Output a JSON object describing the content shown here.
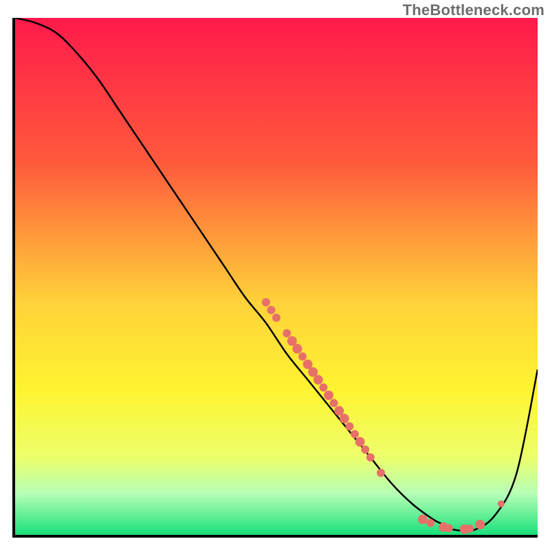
{
  "watermark": "TheBottleneck.com",
  "chart_data": {
    "type": "line",
    "title": "",
    "xlabel": "",
    "ylabel": "",
    "xlim": [
      0,
      100
    ],
    "ylim": [
      0,
      100
    ],
    "grid": false,
    "legend": false,
    "gradient_stops": [
      {
        "offset": 0,
        "color": "#ff1a4b"
      },
      {
        "offset": 28,
        "color": "#ff5a3c"
      },
      {
        "offset": 55,
        "color": "#ffd23a"
      },
      {
        "offset": 72,
        "color": "#fff431"
      },
      {
        "offset": 85,
        "color": "#ecff6b"
      },
      {
        "offset": 92,
        "color": "#b7ffb7"
      },
      {
        "offset": 100,
        "color": "#18e07a"
      }
    ],
    "series": [
      {
        "name": "bottleneck-curve",
        "x": [
          0,
          4,
          8,
          12,
          16,
          20,
          24,
          28,
          32,
          36,
          40,
          44,
          48,
          52,
          56,
          60,
          64,
          68,
          72,
          76,
          80,
          82,
          84,
          88,
          92,
          96,
          100
        ],
        "y": [
          100,
          99,
          97,
          93,
          88,
          82,
          76,
          70,
          64,
          58,
          52,
          46,
          41,
          35,
          30,
          25,
          20,
          15,
          10,
          6,
          3,
          2,
          1,
          1,
          4,
          12,
          32
        ]
      }
    ],
    "points": [
      {
        "x": 48,
        "y": 45,
        "r": 6
      },
      {
        "x": 49,
        "y": 43.5,
        "r": 6
      },
      {
        "x": 50,
        "y": 42,
        "r": 6
      },
      {
        "x": 52,
        "y": 39,
        "r": 6
      },
      {
        "x": 53,
        "y": 37.5,
        "r": 7
      },
      {
        "x": 54,
        "y": 36,
        "r": 7
      },
      {
        "x": 55,
        "y": 34.5,
        "r": 6
      },
      {
        "x": 56,
        "y": 33,
        "r": 7
      },
      {
        "x": 57,
        "y": 31.5,
        "r": 7
      },
      {
        "x": 58,
        "y": 30,
        "r": 7
      },
      {
        "x": 59,
        "y": 28.5,
        "r": 6
      },
      {
        "x": 60,
        "y": 27,
        "r": 7
      },
      {
        "x": 61,
        "y": 25.5,
        "r": 6
      },
      {
        "x": 62,
        "y": 24,
        "r": 7
      },
      {
        "x": 63,
        "y": 22.5,
        "r": 7
      },
      {
        "x": 64,
        "y": 21,
        "r": 6
      },
      {
        "x": 65,
        "y": 19.5,
        "r": 6
      },
      {
        "x": 66,
        "y": 18,
        "r": 7
      },
      {
        "x": 67,
        "y": 16.5,
        "r": 6
      },
      {
        "x": 68,
        "y": 15,
        "r": 6
      },
      {
        "x": 70,
        "y": 12,
        "r": 6
      },
      {
        "x": 78,
        "y": 3,
        "r": 7
      },
      {
        "x": 79.5,
        "y": 2.3,
        "r": 6
      },
      {
        "x": 82,
        "y": 1.5,
        "r": 7
      },
      {
        "x": 83,
        "y": 1.3,
        "r": 6
      },
      {
        "x": 86,
        "y": 1.1,
        "r": 7
      },
      {
        "x": 87,
        "y": 1.2,
        "r": 6
      },
      {
        "x": 89,
        "y": 2,
        "r": 7
      },
      {
        "x": 93,
        "y": 6,
        "r": 5
      }
    ],
    "point_style": {
      "fill": "#e77069",
      "stroke": "#e77069"
    },
    "curve_style": {
      "stroke": "#000000",
      "width": 2.5
    }
  }
}
